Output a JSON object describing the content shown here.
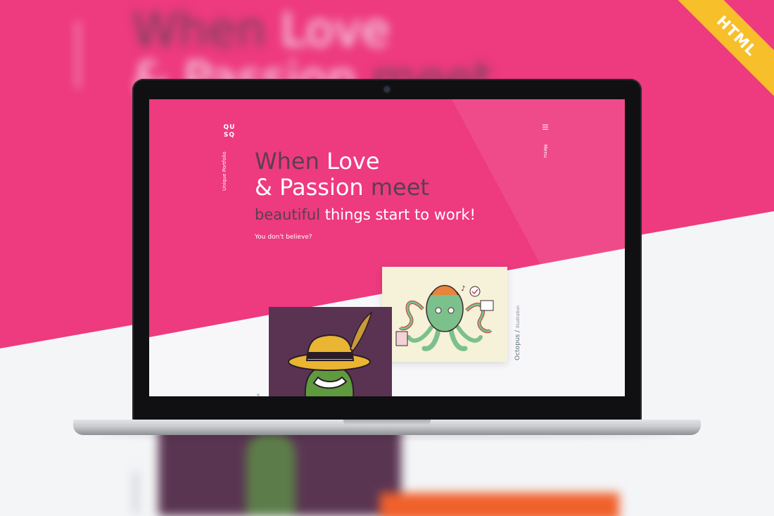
{
  "badge": {
    "label": "HTML",
    "color": "#f7bf2a"
  },
  "background": {
    "headline_line1_dark": "When",
    "headline_line1_light": "Love",
    "headline_line2_dark": "& Passion",
    "headline_line2_light": "meet"
  },
  "site": {
    "logo": [
      "QU",
      "SQ"
    ],
    "tagline": "Unique Portfolio",
    "menu_label": "Menu",
    "menu_icon": "hamburger-icon",
    "accent_color": "#ee3a7f",
    "hero": {
      "line1_dark": "When",
      "line1_light": "Love",
      "line2_light": "& Passion",
      "line2_dark": "meet",
      "line3_dark": "beautiful",
      "line3_light": "things start to",
      "line3_dark2": "work!",
      "cta": "You don't believe?"
    },
    "projects": [
      {
        "title": "Octopus",
        "separator": "/",
        "category": "Illustration"
      },
      {
        "title": "",
        "category": "",
        "caption_glyph": "s"
      }
    ]
  }
}
